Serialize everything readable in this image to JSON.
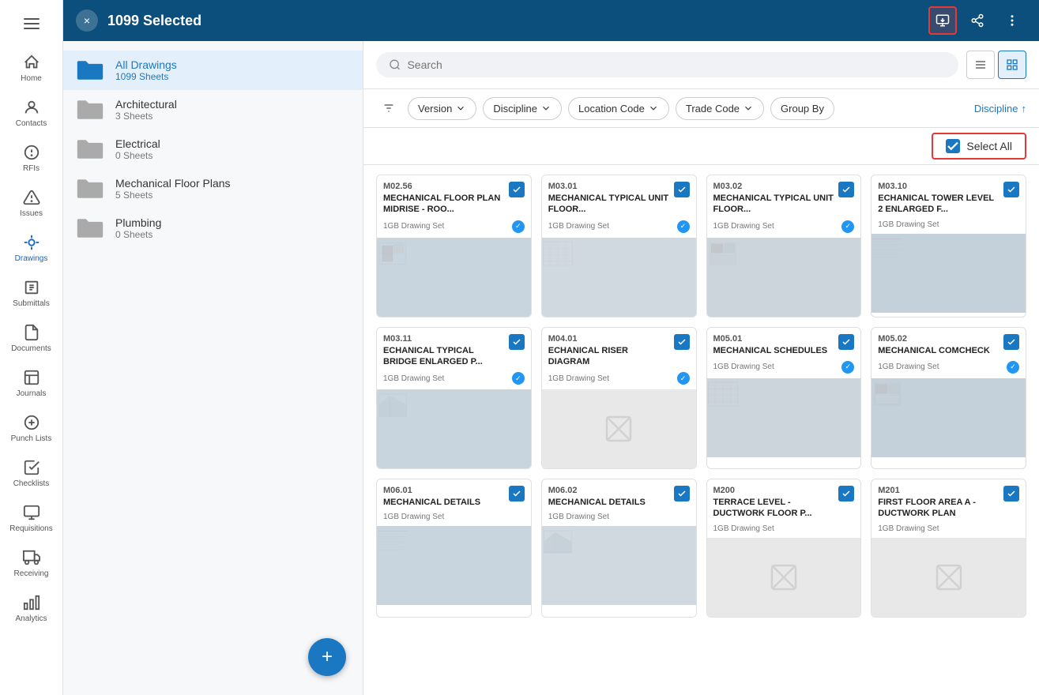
{
  "topBar": {
    "title": "1099 Selected",
    "closeLabel": "×"
  },
  "sidebar": {
    "hamburger": "menu",
    "items": [
      {
        "id": "home",
        "label": "Home",
        "icon": "home"
      },
      {
        "id": "contacts",
        "label": "Contacts",
        "icon": "person"
      },
      {
        "id": "rfis",
        "label": "RFIs",
        "icon": "info"
      },
      {
        "id": "issues",
        "label": "Issues",
        "icon": "warning"
      },
      {
        "id": "drawings",
        "label": "Drawings",
        "icon": "drawings",
        "active": true
      },
      {
        "id": "submittals",
        "label": "Submittals",
        "icon": "submittals"
      },
      {
        "id": "documents",
        "label": "Documents",
        "icon": "documents"
      },
      {
        "id": "journals",
        "label": "Journals",
        "icon": "journals"
      },
      {
        "id": "punchlists",
        "label": "Punch Lists",
        "icon": "punch"
      },
      {
        "id": "checklists",
        "label": "Checklists",
        "icon": "checklists"
      },
      {
        "id": "requisitions",
        "label": "Requisitions",
        "icon": "requisitions"
      },
      {
        "id": "receiving",
        "label": "Receiving",
        "icon": "receiving"
      },
      {
        "id": "analytics",
        "label": "Analytics",
        "icon": "analytics"
      }
    ]
  },
  "leftPanel": {
    "folders": [
      {
        "id": "all",
        "name": "All Drawings",
        "count": "1099 Sheets",
        "selected": true
      },
      {
        "id": "arch",
        "name": "Architectural",
        "count": "3 Sheets",
        "selected": false
      },
      {
        "id": "elec",
        "name": "Electrical",
        "count": "0 Sheets",
        "selected": false
      },
      {
        "id": "mech",
        "name": "Mechanical Floor Plans",
        "count": "5 Sheets",
        "selected": false
      },
      {
        "id": "plumb",
        "name": "Plumbing",
        "count": "0 Sheets",
        "selected": false
      }
    ],
    "addButton": "+"
  },
  "toolbar": {
    "searchPlaceholder": "Search",
    "filters": [
      {
        "id": "version",
        "label": "Version"
      },
      {
        "id": "discipline",
        "label": "Discipline"
      },
      {
        "id": "location",
        "label": "Location Code"
      },
      {
        "id": "trade",
        "label": "Trade Code"
      },
      {
        "id": "groupby",
        "label": "Group By"
      }
    ],
    "sortLabel": "Discipline",
    "sortDir": "↑",
    "selectAllLabel": "Select All"
  },
  "drawings": [
    {
      "id": "m02-56",
      "code": "M02.56",
      "title": "MECHANICAL FLOOR PLAN MIDRISE - ROO...",
      "set": "1GB Drawing Set",
      "verified": true,
      "checked": true,
      "hasThumb": true
    },
    {
      "id": "m03-01",
      "code": "M03.01",
      "title": "MECHANICAL TYPICAL UNIT FLOOR...",
      "set": "1GB Drawing Set",
      "verified": true,
      "checked": true,
      "hasThumb": true
    },
    {
      "id": "m03-02",
      "code": "M03.02",
      "title": "MECHANICAL TYPICAL UNIT FLOOR...",
      "set": "1GB Drawing Set",
      "verified": true,
      "checked": true,
      "hasThumb": true
    },
    {
      "id": "m03-10",
      "code": "M03.10",
      "title": "ECHANICAL TOWER LEVEL 2 ENLARGED F...",
      "set": "1GB Drawing Set",
      "verified": false,
      "checked": true,
      "hasThumb": true
    },
    {
      "id": "m03-11",
      "code": "M03.11",
      "title": "ECHANICAL TYPICAL BRIDGE ENLARGED P...",
      "set": "1GB Drawing Set",
      "verified": true,
      "checked": true,
      "hasThumb": true
    },
    {
      "id": "m04-01",
      "code": "M04.01",
      "title": "ECHANICAL RISER DIAGRAM",
      "set": "1GB Drawing Set",
      "verified": true,
      "checked": true,
      "hasThumb": false
    },
    {
      "id": "m05-01",
      "code": "M05.01",
      "title": "MECHANICAL SCHEDULES",
      "set": "1GB Drawing Set",
      "verified": true,
      "checked": true,
      "hasThumb": true
    },
    {
      "id": "m05-02",
      "code": "M05.02",
      "title": "MECHANICAL COMCHECK",
      "set": "1GB Drawing Set",
      "verified": true,
      "checked": true,
      "hasThumb": true
    },
    {
      "id": "m06-01",
      "code": "M06.01",
      "title": "MECHANICAL DETAILS",
      "set": "1GB Drawing Set",
      "verified": false,
      "checked": true,
      "hasThumb": true
    },
    {
      "id": "m06-02",
      "code": "M06.02",
      "title": "MECHANICAL DETAILS",
      "set": "1GB Drawing Set",
      "verified": false,
      "checked": true,
      "hasThumb": true
    },
    {
      "id": "m200",
      "code": "M200",
      "title": "TERRACE LEVEL - DUCTWORK FLOOR  P...",
      "set": "1GB Drawing Set",
      "verified": false,
      "checked": true,
      "hasThumb": false
    },
    {
      "id": "m201",
      "code": "M201",
      "title": "FIRST FLOOR AREA A - DUCTWORK PLAN",
      "set": "1GB Drawing Set",
      "verified": false,
      "checked": true,
      "hasThumb": false
    }
  ]
}
